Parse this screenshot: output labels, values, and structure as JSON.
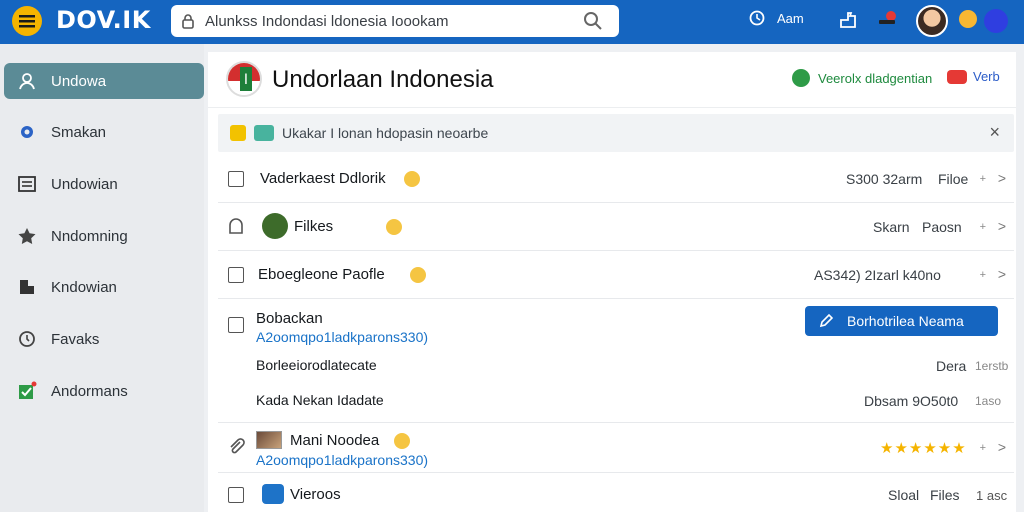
{
  "topbar": {
    "logo": "DOV.IK",
    "search_value": "Alunkss Indondasi ldonesia Ioookam",
    "account_label": "Aam"
  },
  "sidebar": {
    "items": [
      {
        "label": "Undowa",
        "icon": "user-icon",
        "active": true
      },
      {
        "label": "Smakan",
        "icon": "gear-icon"
      },
      {
        "label": "Undowian",
        "icon": "list-icon"
      },
      {
        "label": "Nndomning",
        "icon": "star-icon"
      },
      {
        "label": "Kndowian",
        "icon": "folder-icon"
      },
      {
        "label": "Favaks",
        "icon": "clock-icon"
      },
      {
        "label": "Andormans",
        "icon": "check-icon"
      }
    ]
  },
  "header": {
    "title": "Undorlaan Indonesia",
    "verify_label": "Veerolx dladgentian",
    "badge_label": "Verb"
  },
  "notice": {
    "text": "Ukakar I lonan hdopasin neoarbe",
    "close": "×"
  },
  "rows": [
    {
      "title": "Vaderkaest Ddlorik",
      "right": "S300 32arm",
      "right_accent": "Filoe"
    },
    {
      "title": "Filkes",
      "right": "Skarn",
      "right_accent": "Paosn"
    },
    {
      "title": "Eboegleone Paofle",
      "right": "AS342)  2Izarl k40no",
      "right_accent": ""
    },
    {
      "title": "Bobackan",
      "subtitle": "A2oomqpo1ladkparons330)",
      "cta": "Borhotrilea Neama",
      "sub_rows": [
        {
          "label": "Borleeiorodlatecate",
          "value": "Dera",
          "meta": "1erstb"
        },
        {
          "label": "Kada Nekan Idadate",
          "value": "Dbsam 9O50t0",
          "meta": "1aso"
        }
      ]
    },
    {
      "title": "Mani Noodea",
      "subtitle": "A2oomqpo1ladkparons330)",
      "stars": "★★★★★★"
    },
    {
      "title": "Vieroos",
      "right": "Sloal",
      "right_accent": "Files",
      "meta": "1 asc"
    }
  ],
  "colors": {
    "topbar": "#1565c0",
    "accent_green": "#2e9b47",
    "cta": "#1565c0"
  }
}
